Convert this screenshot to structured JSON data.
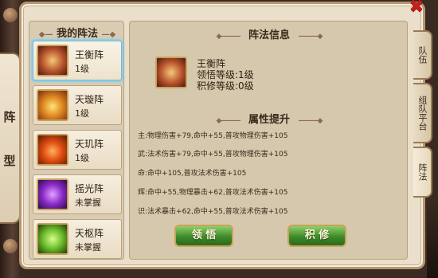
{
  "window": {
    "close_label": "✖"
  },
  "side": {
    "tab_chars": [
      "阵",
      "型"
    ]
  },
  "list": {
    "title": "我的阵法",
    "items": [
      {
        "name": "王衡阵",
        "level": "1级",
        "icon": "wangheng-formation-icon"
      },
      {
        "name": "天璇阵",
        "level": "1级",
        "icon": "tianxuan-formation-icon"
      },
      {
        "name": "天玑阵",
        "level": "1级",
        "icon": "tianji-formation-icon"
      },
      {
        "name": "摇光阵",
        "level": "未掌握",
        "icon": "yaoguang-formation-icon"
      },
      {
        "name": "天枢阵",
        "level": "未掌握",
        "icon": "tianshu-formation-icon"
      }
    ]
  },
  "info": {
    "title": "阵法信息",
    "name": "王衡阵",
    "learn_level": "领悟等级:1级",
    "train_level": "积修等级:0级",
    "attr_title": "属性提升",
    "attrs": [
      "主:物理伤害+79,命中+55,普攻物理伤害+105",
      "武:法术伤害+79,命中+55,普攻物理伤害+105",
      "命:命中+105,普攻法术伤害+105",
      "辉:命中+55,物理暴击+62,普攻法术伤害+105",
      "识:法术暴击+62,命中+55,普攻法术伤害+105"
    ],
    "buttons": {
      "learn": "领 悟",
      "train": "积 修"
    }
  },
  "right_tabs": [
    {
      "label": "队伍",
      "active": false
    },
    {
      "label": "组队平台",
      "active": false
    },
    {
      "label": "阵法",
      "active": true
    }
  ],
  "colors": {
    "frame_bg": "#eadfca",
    "panel_bg": "#d6c8ac",
    "button_green": "#3f8a2a",
    "selected_glow": "#8fd0e8",
    "close_red": "#c71f1a"
  }
}
